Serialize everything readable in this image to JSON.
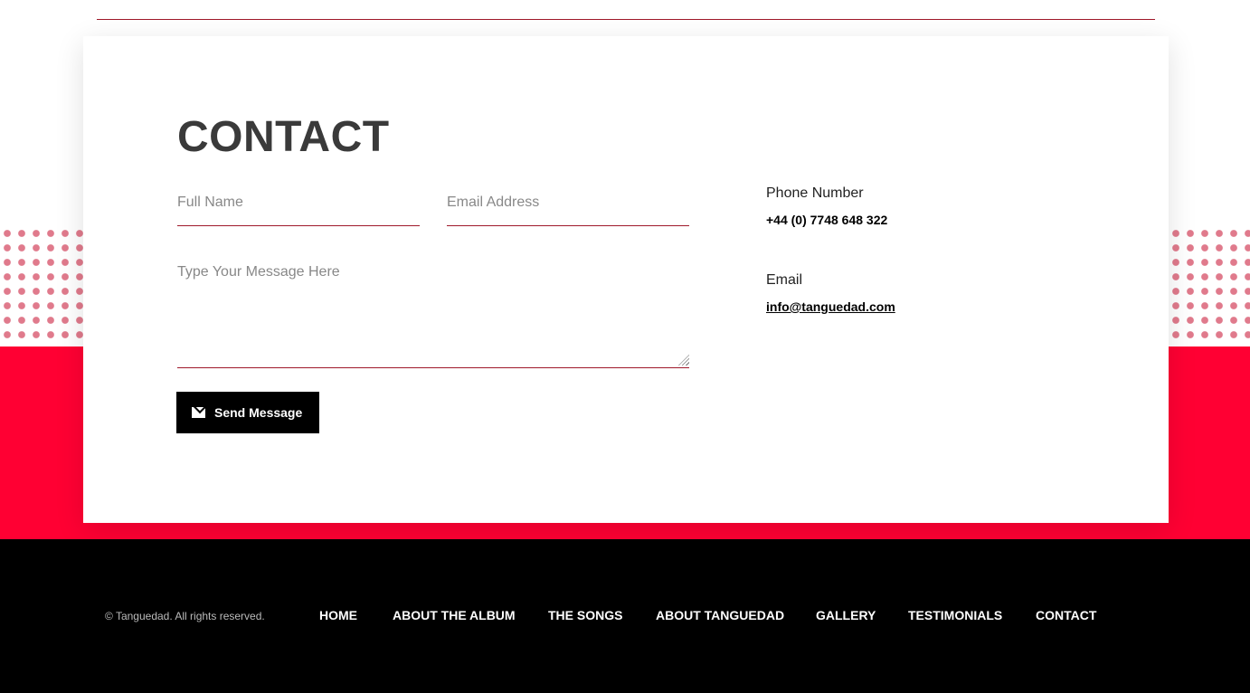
{
  "contact": {
    "title": "CONTACT",
    "full_name_placeholder": "Full Name",
    "email_placeholder": "Email Address",
    "message_placeholder": "Type Your Message Here",
    "send_label": "Send Message",
    "phone_label": "Phone Number",
    "phone_value": "+44 (0) 7748 648 322",
    "email_label": "Email",
    "email_value": "info@tanguedad.com"
  },
  "colors": {
    "accent": "#ff0033",
    "underline": "#a0192b"
  },
  "footer": {
    "copyright": "© Tanguedad. All rights reserved.",
    "nav": [
      "HOME",
      "ABOUT THE ALBUM",
      "THE SONGS",
      "ABOUT TANGUEDAD",
      "GALLERY",
      "TESTIMONIALS",
      "CONTACT"
    ]
  }
}
